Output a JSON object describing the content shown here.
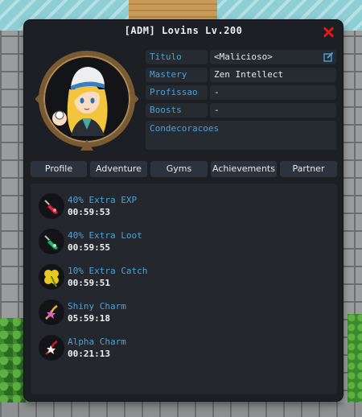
{
  "window": {
    "title": "[ADM] Lovins Lv.200"
  },
  "profile": {
    "rows": [
      {
        "label": "Titulo",
        "value": "<Malicioso>"
      },
      {
        "label": "Mastery",
        "value": "Zen Intellect"
      },
      {
        "label": "Profissao",
        "value": "-"
      },
      {
        "label": "Boosts",
        "value": "-"
      }
    ],
    "decor_label": "Condecoracoes"
  },
  "tabs": [
    "Profile",
    "Adventure",
    "Gyms",
    "Achievements",
    "Partner"
  ],
  "boosts": [
    {
      "name": "40% Extra EXP",
      "time": "00:59:53",
      "icon": "red-potion-icon"
    },
    {
      "name": "40% Extra Loot",
      "time": "00:59:55",
      "icon": "green-potion-icon"
    },
    {
      "name": "10% Extra Catch",
      "time": "00:59:51",
      "icon": "clover-icon"
    },
    {
      "name": "Shiny Charm",
      "time": "05:59:18",
      "icon": "shiny-charm-icon"
    },
    {
      "name": "Alpha Charm",
      "time": "00:21:13",
      "icon": "alpha-charm-icon"
    }
  ],
  "colors": {
    "accent_label": "#4aa3d6",
    "close": "#e01a1a",
    "window_bg": "#1c1f24"
  }
}
